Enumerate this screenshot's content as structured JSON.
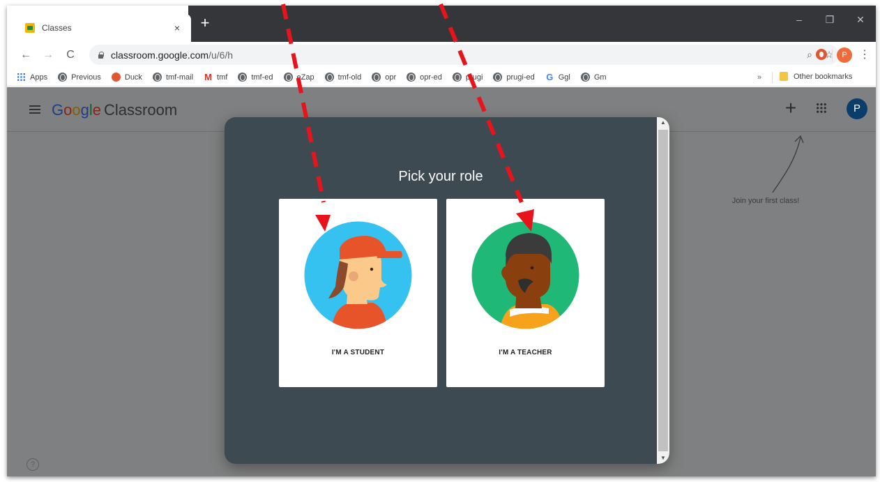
{
  "browser": {
    "tab_title": "Classes",
    "tab_close": "×",
    "new_tab": "+",
    "window_controls": [
      "–",
      "❐",
      "✕"
    ],
    "url_host": "classroom.google.com",
    "url_path": "/u/6/h",
    "zoom_icon": "⌕",
    "star_icon": "☆",
    "profile_initial": "P",
    "menu_icon": "⋮"
  },
  "bookmarks": {
    "items": [
      {
        "label": "Apps",
        "icon": "apps-grid-icon"
      },
      {
        "label": "Previous",
        "icon": "globe-icon"
      },
      {
        "label": "Duck",
        "icon": "duckduckgo-icon"
      },
      {
        "label": "tmf-mail",
        "icon": "globe-icon"
      },
      {
        "label": "tmf",
        "icon": "gmail-icon"
      },
      {
        "label": "tmf-ed",
        "icon": "globe-icon"
      },
      {
        "label": "eZap",
        "icon": "globe-icon"
      },
      {
        "label": "tmf-old",
        "icon": "globe-icon"
      },
      {
        "label": "opr",
        "icon": "globe-icon"
      },
      {
        "label": "opr-ed",
        "icon": "globe-icon"
      },
      {
        "label": "prugi",
        "icon": "globe-icon"
      },
      {
        "label": "prugi-ed",
        "icon": "globe-icon"
      },
      {
        "label": "Ggl",
        "icon": "google-icon"
      },
      {
        "label": "Gm",
        "icon": "globe-icon"
      }
    ],
    "chevron": "»",
    "other": "Other bookmarks"
  },
  "app": {
    "brand_google": [
      "G",
      "o",
      "o",
      "g",
      "l",
      "e"
    ],
    "brand_product": "Classroom",
    "plus_label": "+",
    "avatar_initial": "P",
    "join_hint": "Join your first class!",
    "help": "?"
  },
  "dialog": {
    "title": "Pick your role",
    "student_label": "I'M A STUDENT",
    "teacher_label": "I'M A TEACHER"
  },
  "colors": {
    "overlay_page": "#7f8081",
    "dialog_bg": "#3d4a52",
    "annotation": "#e8141b",
    "student_circle": "#35c2f0",
    "teacher_circle": "#1fb877"
  }
}
